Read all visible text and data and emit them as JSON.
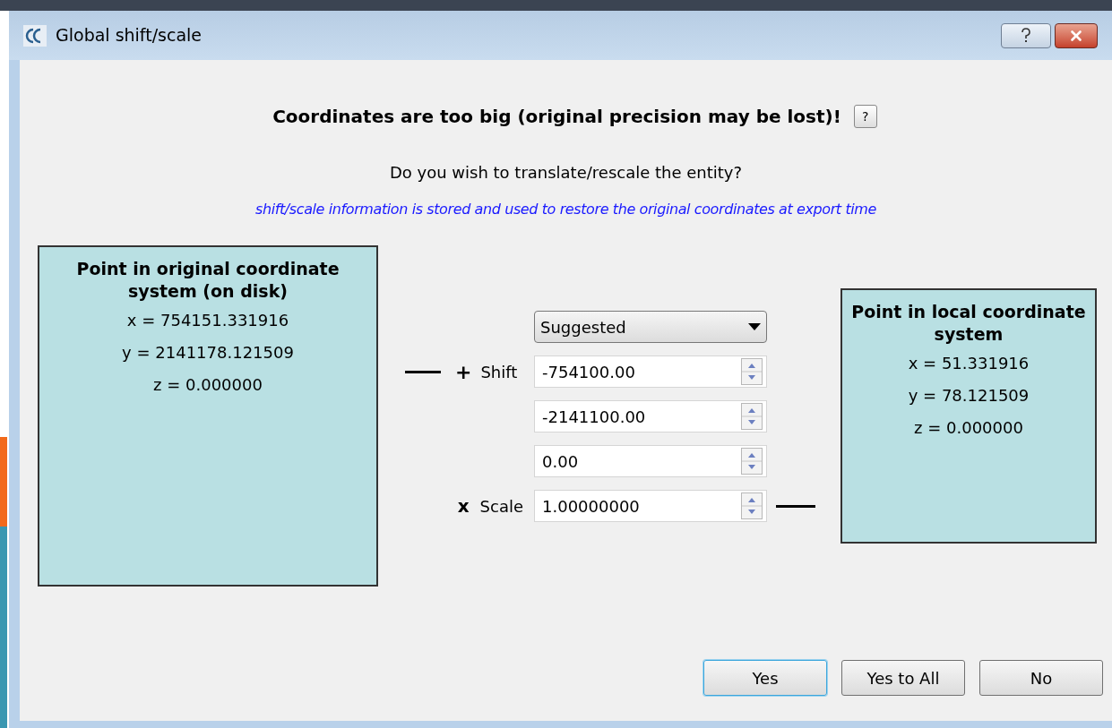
{
  "window": {
    "title": "Global shift/scale"
  },
  "heading": "Coordinates are too big (original precision may be lost)!",
  "help_button": "?",
  "question": "Do you wish to translate/rescale the entity?",
  "info": "shift/scale information is stored and used to restore the original coordinates at export time",
  "original_point": {
    "title": "Point in original coordinate system (on disk)",
    "lines": [
      "x = 754151.331916",
      "y = 2141178.121509",
      "z = 0.000000"
    ]
  },
  "mode_dropdown": {
    "value": "Suggested"
  },
  "shift": {
    "sign": "+",
    "label": "Shift",
    "values": [
      "-754100.00",
      "-2141100.00",
      "0.00"
    ]
  },
  "scale": {
    "sign": "x",
    "label": "Scale",
    "value": "1.00000000"
  },
  "local_point": {
    "title": "Point in local coordinate system",
    "lines": [
      "x = 51.331916",
      "y = 78.121509",
      "z = 0.000000"
    ]
  },
  "buttons": [
    {
      "label": "Yes",
      "default": true
    },
    {
      "label": "Yes to All",
      "default": false
    },
    {
      "label": "No",
      "default": false
    }
  ]
}
